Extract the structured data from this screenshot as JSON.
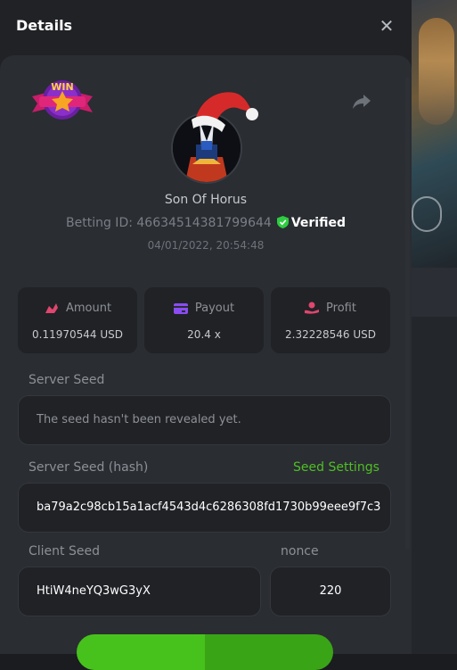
{
  "header": {
    "title": "Details",
    "close_icon": "close-icon"
  },
  "profile": {
    "badge_text": "WIN",
    "username": "Son Of Horus",
    "betting_id": "Betting ID: 46634514381799644",
    "verified": "Verified",
    "timestamp": "04/01/2022, 20:54:48"
  },
  "stats": [
    {
      "label": "Amount",
      "value": "0.11970544 USD",
      "icon": "amount-icon",
      "color": "#e0466e"
    },
    {
      "label": "Payout",
      "value": "20.4 x",
      "icon": "card-icon",
      "color": "#8b4cf3"
    },
    {
      "label": "Profit",
      "value": "2.32228546 USD",
      "icon": "profit-icon",
      "color": "#e0466e"
    }
  ],
  "server_seed": {
    "label": "Server Seed",
    "value": "The seed hasn't been revealed yet."
  },
  "server_hash": {
    "label": "Server Seed (hash)",
    "link": "Seed Settings",
    "value": "ba79a2c98cb15a1acf4543d4c6286308fd1730b99eee9f7c3"
  },
  "client_seed": {
    "label": "Client Seed",
    "value": "HtiW4neYQ3wG3yX"
  },
  "nonce": {
    "label": "nonce",
    "value": "220"
  },
  "colors": {
    "accent": "#4fbf26",
    "verified": "#2ecc40"
  }
}
